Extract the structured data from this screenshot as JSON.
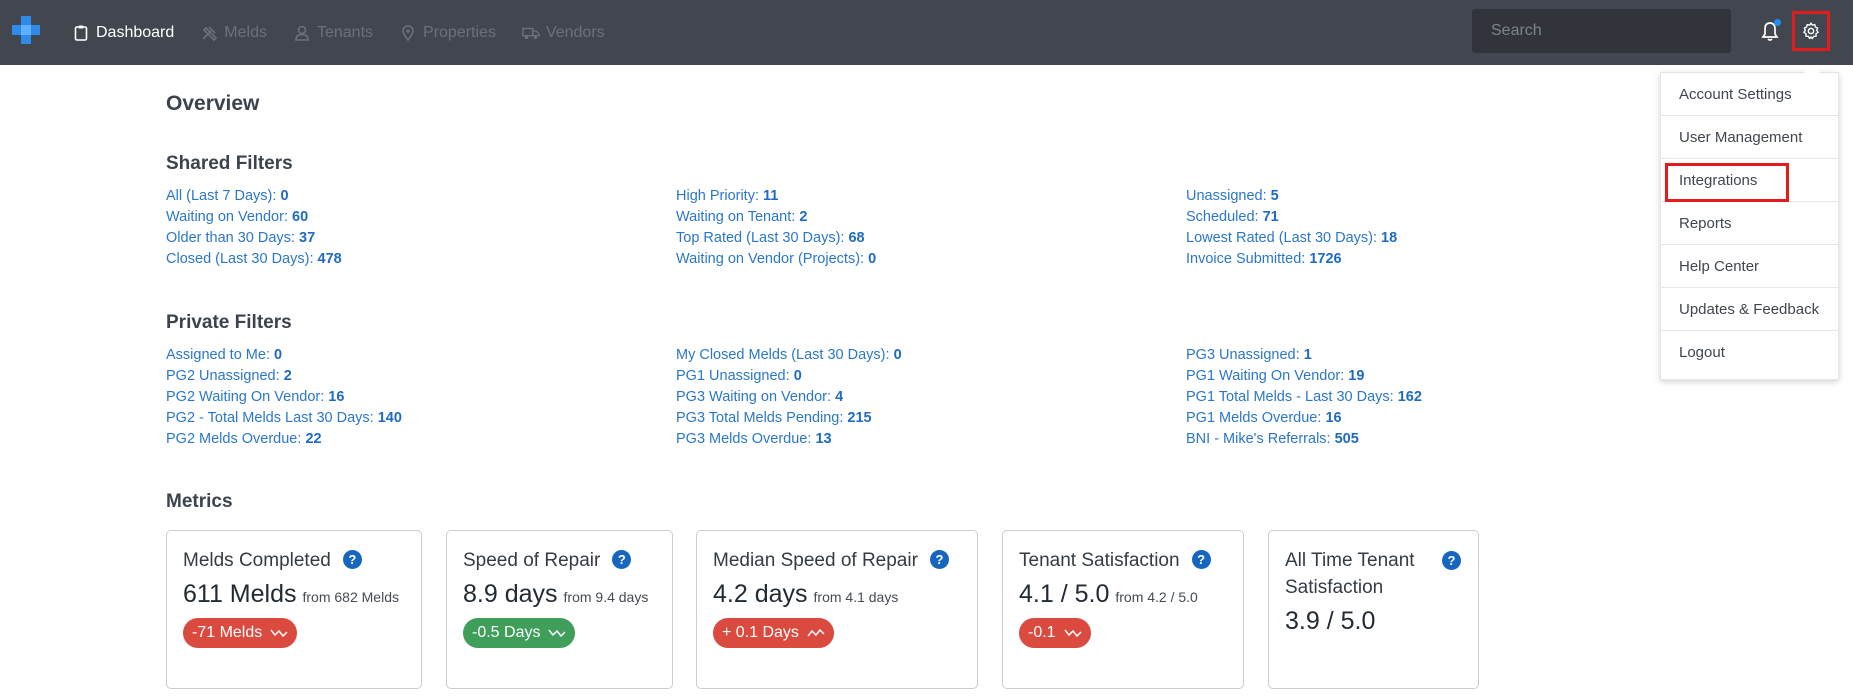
{
  "nav": {
    "items": [
      {
        "label": "Dashboard",
        "icon": "clipboard-icon",
        "active": true
      },
      {
        "label": "Melds",
        "icon": "tools-icon",
        "active": false
      },
      {
        "label": "Tenants",
        "icon": "person-icon",
        "active": false
      },
      {
        "label": "Properties",
        "icon": "map-pin-icon",
        "active": false
      },
      {
        "label": "Vendors",
        "icon": "truck-icon",
        "active": false
      }
    ],
    "search_placeholder": "Search"
  },
  "page_title": "Overview",
  "shared_filters": {
    "title": "Shared Filters",
    "columns": [
      [
        {
          "label": "All (Last 7 Days):",
          "count": "0"
        },
        {
          "label": "Waiting on Vendor:",
          "count": "60"
        },
        {
          "label": "Older than 30 Days:",
          "count": "37"
        },
        {
          "label": "Closed (Last 30 Days):",
          "count": "478"
        }
      ],
      [
        {
          "label": "High Priority:",
          "count": "11"
        },
        {
          "label": "Waiting on Tenant:",
          "count": "2"
        },
        {
          "label": "Top Rated (Last 30 Days):",
          "count": "68"
        },
        {
          "label": "Waiting on Vendor (Projects):",
          "count": "0"
        }
      ],
      [
        {
          "label": "Unassigned:",
          "count": "5"
        },
        {
          "label": "Scheduled:",
          "count": "71"
        },
        {
          "label": "Lowest Rated (Last 30 Days):",
          "count": "18"
        },
        {
          "label": "Invoice Submitted:",
          "count": "1726"
        }
      ]
    ]
  },
  "private_filters": {
    "title": "Private Filters",
    "columns": [
      [
        {
          "label": "Assigned to Me:",
          "count": "0"
        },
        {
          "label": "PG2 Unassigned:",
          "count": "2"
        },
        {
          "label": "PG2 Waiting On Vendor:",
          "count": "16"
        },
        {
          "label": "PG2 - Total Melds Last 30 Days:",
          "count": "140"
        },
        {
          "label": "PG2 Melds Overdue:",
          "count": "22"
        }
      ],
      [
        {
          "label": "My Closed Melds (Last 30 Days):",
          "count": "0"
        },
        {
          "label": "PG1 Unassigned:",
          "count": "0"
        },
        {
          "label": "PG3 Waiting on Vendor:",
          "count": "4"
        },
        {
          "label": "PG3 Total Melds Pending:",
          "count": "215"
        },
        {
          "label": "PG3 Melds Overdue:",
          "count": "13"
        }
      ],
      [
        {
          "label": "PG3 Unassigned:",
          "count": "1"
        },
        {
          "label": "PG1 Waiting On Vendor:",
          "count": "19"
        },
        {
          "label": "PG1 Total Melds - Last 30 Days:",
          "count": "162"
        },
        {
          "label": "PG1 Melds Overdue:",
          "count": "16"
        },
        {
          "label": "BNI - Mike's Referrals:",
          "count": "505"
        }
      ]
    ]
  },
  "metrics": {
    "title": "Metrics",
    "cards": [
      {
        "title": "Melds Completed",
        "value": "611 Melds",
        "from": "from 682 Melds",
        "badge": "-71 Melds",
        "badge_color": "#db4a3f",
        "trend": "down"
      },
      {
        "title": "Speed of Repair",
        "value": "8.9 days",
        "from": "from 9.4 days",
        "badge": "-0.5 Days",
        "badge_color": "#3f9e5a",
        "trend": "down"
      },
      {
        "title": "Median Speed of Repair",
        "value": "4.2 days",
        "from": "from 4.1 days",
        "badge": "+ 0.1 Days",
        "badge_color": "#db4a3f",
        "trend": "up"
      },
      {
        "title": "Tenant Satisfaction",
        "value": "4.1 / 5.0",
        "from": "from 4.2 / 5.0",
        "badge": "-0.1",
        "badge_color": "#db4a3f",
        "trend": "down"
      },
      {
        "title": "All Time Tenant Satisfaction",
        "value": "3.9 / 5.0",
        "from": "",
        "badge": "",
        "badge_color": "",
        "trend": ""
      }
    ],
    "help_label": "?"
  },
  "settings_menu": {
    "items": [
      "Account Settings",
      "User Management",
      "Integrations",
      "Reports",
      "Help Center",
      "Updates & Feedback",
      "Logout"
    ],
    "highlighted_index": 2
  },
  "colors": {
    "topbar": "#42474f",
    "link": "#2a77c9",
    "highlight": "#e31b1b",
    "help": "#1666c0"
  }
}
